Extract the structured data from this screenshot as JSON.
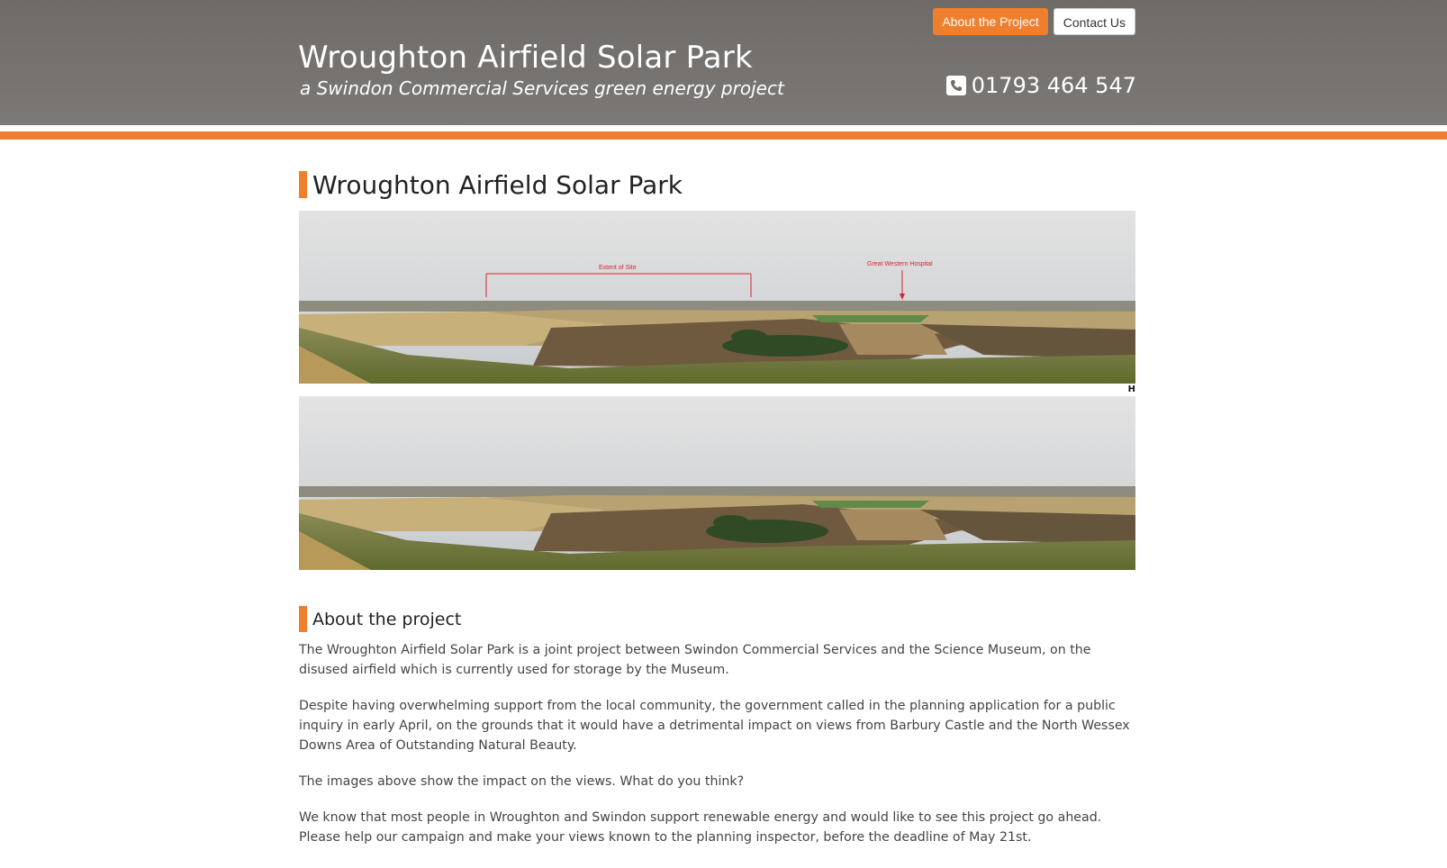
{
  "nav": {
    "about_label": "About the Project",
    "contact_label": "Contact Us"
  },
  "header": {
    "title": "Wroughton Airfield Solar Park",
    "subtitle": "a Swindon Commercial Services green energy project",
    "phone": "01793 464 547"
  },
  "main": {
    "heading": "Wroughton Airfield Solar Park",
    "panorama_top": {
      "annotation_site": "Extent of Site",
      "annotation_hospital": "Great Western Hospital",
      "corner_label": "H"
    },
    "about_heading": "About the project",
    "paragraphs": [
      "The Wroughton Airfield Solar Park is a joint project between Swindon Commercial Services and the Science Museum, on the disused airfield which is currently used for storage by the Museum.",
      "Despite having  overwhelming support from the local community, the government called in the planning application for a public inquiry in early April, on the grounds that it would have a detrimental impact on views from Barbury Castle and the North Wessex Downs Area of Outstanding Natural Beauty.",
      "The images above show the impact on the views. What do you think?",
      "We know that most people in Wroughton and Swindon support renewable energy and would like to see this project go ahead. Please help our campaign and make your views known to the planning inspector, before the deadline of May 21st."
    ]
  },
  "colors": {
    "accent": "#ef7f2d",
    "header_bg": "#7a7775"
  },
  "icons": {
    "phone": "phone-icon"
  }
}
